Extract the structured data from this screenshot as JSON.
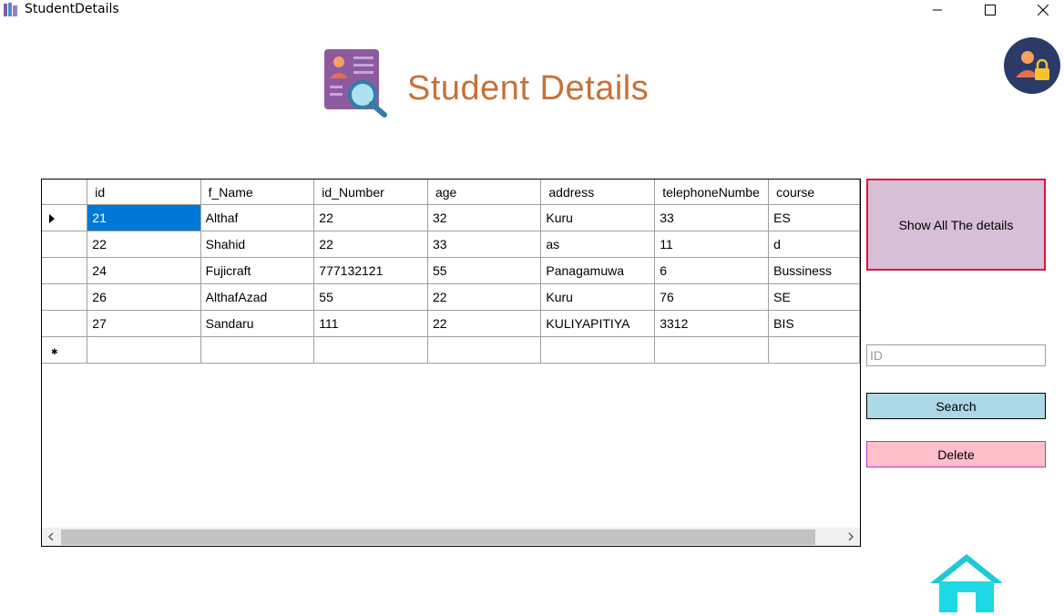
{
  "window": {
    "title": "StudentDetails",
    "minimize_glyph": "—",
    "maximize_glyph": "☐",
    "close_glyph": "✕"
  },
  "header": {
    "title": "Student Details",
    "title_color": "#c87137",
    "icons": [
      "student-card-search-icon",
      "user-lock-icon"
    ]
  },
  "grid": {
    "columns": [
      "id",
      "f_Name",
      "id_Number",
      "age",
      "address",
      "telephoneNumbe",
      "course"
    ],
    "rows": [
      [
        "21",
        "Althaf",
        "22",
        "32",
        "Kuru",
        "33",
        "ES"
      ],
      [
        "22",
        "Shahid",
        "22",
        "33",
        "as",
        "11",
        "d"
      ],
      [
        "24",
        "Fujicraft",
        "777132121",
        "55",
        "Panagamuwa",
        "6",
        "Bussiness"
      ],
      [
        "26",
        "AlthafAzad",
        "55",
        "22",
        "Kuru",
        "76",
        "SE"
      ],
      [
        "27",
        "Sandaru",
        "111",
        "22",
        "KULIYAPITIYA",
        "3312",
        "BIS"
      ]
    ],
    "selected_row": 0,
    "selected_color": "#0078d7",
    "new_row_marker": "✱"
  },
  "actions": {
    "show_all_label": "Show All The details",
    "id_placeholder": "ID",
    "id_value": "",
    "search_label": "Search",
    "delete_label": "Delete",
    "show_all_color": "#d8bfd8",
    "search_color": "#add8e6",
    "delete_color": "#ffc0cb"
  },
  "footer": {
    "home_icon": "home-icon"
  }
}
